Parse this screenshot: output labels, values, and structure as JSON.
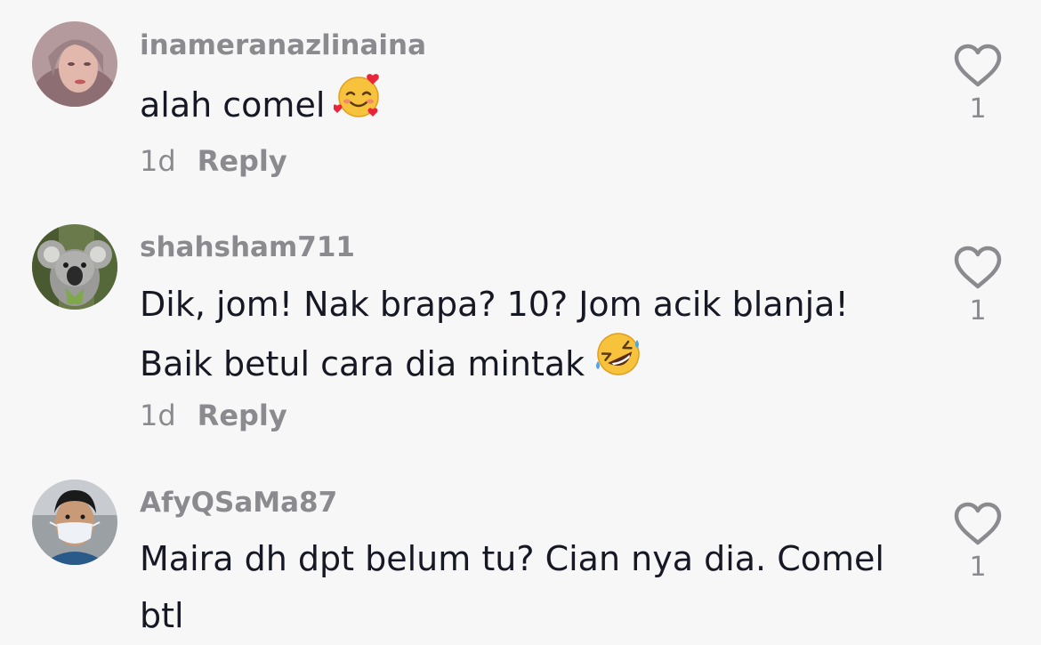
{
  "comments": [
    {
      "username": "inameranazlinaina",
      "lines": [
        "alah comel"
      ],
      "emoji": "smiling-face-with-hearts",
      "time": "1d",
      "reply_label": "Reply",
      "like_count": "1"
    },
    {
      "username": "shahsham711",
      "lines": [
        "Dik, jom! Nak brapa? 10? Jom acik blanja!",
        "Baik betul cara dia mintak"
      ],
      "emoji": "rolling-on-the-floor-laughing",
      "time": "1d",
      "reply_label": "Reply",
      "like_count": "1"
    },
    {
      "username": "AfyQSaMa87",
      "lines": [
        "Maira dh dpt belum tu? Cian nya dia. Comel",
        "btl"
      ],
      "like_count": "1"
    }
  ],
  "colors": {
    "background": "#f8f7f8",
    "text_primary": "#161823",
    "text_secondary": "#8b8b8f"
  }
}
